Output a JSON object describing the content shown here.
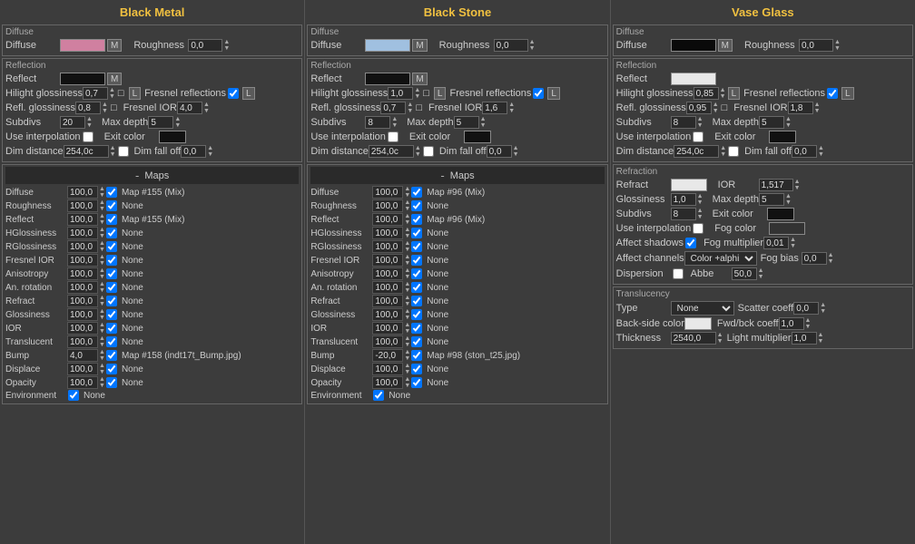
{
  "panels": [
    {
      "id": "black-metal",
      "title": "Black Metal",
      "diffuse": {
        "label": "Diffuse",
        "swatch": "swatch-pink",
        "roughness_label": "Roughness",
        "roughness_val": "0,0"
      },
      "reflection": {
        "label": "Reflection",
        "reflect_label": "Reflect",
        "reflect_swatch": "swatch-black",
        "hilight_gloss_label": "Hilight glossiness",
        "hilight_gloss_val": "0,7",
        "fresnel_refl_label": "Fresnel reflections",
        "refl_gloss_label": "Refl. glossiness",
        "refl_gloss_val": "0,8",
        "fresnel_ior_label": "Fresnel IOR",
        "fresnel_ior_val": "4,0",
        "subdivs_label": "Subdivs",
        "subdivs_val": "20",
        "max_depth_label": "Max depth",
        "max_depth_val": "5",
        "use_interp_label": "Use interpolation",
        "exit_color_label": "Exit color",
        "dim_dist_label": "Dim distance",
        "dim_dist_val": "254,0c",
        "dim_fall_label": "Dim fall off",
        "dim_fall_val": "0,0"
      },
      "maps": {
        "label": "Maps",
        "rows": [
          {
            "label": "Diffuse",
            "val": "100,0",
            "name": "Map #155 (Mix)"
          },
          {
            "label": "Roughness",
            "val": "100,0",
            "name": "None"
          },
          {
            "label": "Reflect",
            "val": "100,0",
            "name": "Map #155 (Mix)"
          },
          {
            "label": "HGlossiness",
            "val": "100,0",
            "name": "None"
          },
          {
            "label": "RGlossiness",
            "val": "100,0",
            "name": "None"
          },
          {
            "label": "Fresnel IOR",
            "val": "100,0",
            "name": "None"
          },
          {
            "label": "Anisotropy",
            "val": "100,0",
            "name": "None"
          },
          {
            "label": "An. rotation",
            "val": "100,0",
            "name": "None"
          },
          {
            "label": "Refract",
            "val": "100,0",
            "name": "None"
          },
          {
            "label": "Glossiness",
            "val": "100,0",
            "name": "None"
          },
          {
            "label": "IOR",
            "val": "100,0",
            "name": "None"
          },
          {
            "label": "Translucent",
            "val": "100,0",
            "name": "None"
          },
          {
            "label": "Bump",
            "val": "4,0",
            "name": "Map #158 (indt17t_Bump.jpg)"
          },
          {
            "label": "Displace",
            "val": "100,0",
            "name": "None"
          },
          {
            "label": "Opacity",
            "val": "100,0",
            "name": "None"
          },
          {
            "label": "Environment",
            "val": "",
            "name": "None"
          }
        ]
      }
    },
    {
      "id": "black-stone",
      "title": "Black Stone",
      "diffuse": {
        "label": "Diffuse",
        "swatch": "swatch-lightblue",
        "roughness_label": "Roughness",
        "roughness_val": "0,0"
      },
      "reflection": {
        "label": "Reflection",
        "reflect_label": "Reflect",
        "reflect_swatch": "swatch-black",
        "hilight_gloss_label": "Hilight glossiness",
        "hilight_gloss_val": "1,0",
        "fresnel_refl_label": "Fresnel reflections",
        "refl_gloss_label": "Refl. glossiness",
        "refl_gloss_val": "0,7",
        "fresnel_ior_label": "Fresnel IOR",
        "fresnel_ior_val": "1,6",
        "subdivs_label": "Subdivs",
        "subdivs_val": "8",
        "max_depth_label": "Max depth",
        "max_depth_val": "5",
        "use_interp_label": "Use interpolation",
        "exit_color_label": "Exit color",
        "dim_dist_label": "Dim distance",
        "dim_dist_val": "254,0c",
        "dim_fall_label": "Dim fall off",
        "dim_fall_val": "0,0"
      },
      "maps": {
        "label": "Maps",
        "rows": [
          {
            "label": "Diffuse",
            "val": "100,0",
            "name": "Map #96 (Mix)"
          },
          {
            "label": "Roughness",
            "val": "100,0",
            "name": "None"
          },
          {
            "label": "Reflect",
            "val": "100,0",
            "name": "Map #96 (Mix)"
          },
          {
            "label": "HGlossiness",
            "val": "100,0",
            "name": "None"
          },
          {
            "label": "RGlossiness",
            "val": "100,0",
            "name": "None"
          },
          {
            "label": "Fresnel IOR",
            "val": "100,0",
            "name": "None"
          },
          {
            "label": "Anisotropy",
            "val": "100,0",
            "name": "None"
          },
          {
            "label": "An. rotation",
            "val": "100,0",
            "name": "None"
          },
          {
            "label": "Refract",
            "val": "100,0",
            "name": "None"
          },
          {
            "label": "Glossiness",
            "val": "100,0",
            "name": "None"
          },
          {
            "label": "IOR",
            "val": "100,0",
            "name": "None"
          },
          {
            "label": "Translucent",
            "val": "100,0",
            "name": "None"
          },
          {
            "label": "Bump",
            "val": "-20,0",
            "name": "Map #98 (ston_t25.jpg)"
          },
          {
            "label": "Displace",
            "val": "100,0",
            "name": "None"
          },
          {
            "label": "Opacity",
            "val": "100,0",
            "name": "None"
          },
          {
            "label": "Environment",
            "val": "",
            "name": "None"
          }
        ]
      }
    },
    {
      "id": "vase-glass",
      "title": "Vase Glass",
      "diffuse": {
        "label": "Diffuse",
        "swatch": "swatch-verydark",
        "roughness_label": "Roughness",
        "roughness_val": "0,0"
      },
      "reflection": {
        "label": "Reflection",
        "reflect_label": "Reflect",
        "reflect_swatch": "swatch-nearwhite",
        "hilight_gloss_label": "Hilight glossiness",
        "hilight_gloss_val": "0,85",
        "fresnel_refl_label": "Fresnel reflections",
        "refl_gloss_label": "Refl. glossiness",
        "refl_gloss_val": "0,95",
        "fresnel_ior_label": "Fresnel IOR",
        "fresnel_ior_val": "1,8",
        "subdivs_label": "Subdivs",
        "subdivs_val": "8",
        "max_depth_label": "Max depth",
        "max_depth_val": "5",
        "use_interp_label": "Use interpolation",
        "exit_color_label": "Exit color",
        "dim_dist_label": "Dim distance",
        "dim_dist_val": "254,0c",
        "dim_fall_label": "Dim fall off",
        "dim_fall_val": "0,0"
      },
      "refraction": {
        "label": "Refraction",
        "refract_label": "Refract",
        "refract_swatch": "swatch-nearwhite",
        "ior_label": "IOR",
        "ior_val": "1,517",
        "gloss_label": "Glossiness",
        "gloss_val": "1,0",
        "max_depth_label": "Max depth",
        "max_depth_val": "5",
        "subdivs_label": "Subdivs",
        "subdivs_val": "8",
        "exit_color_label": "Exit color",
        "use_interp_label": "Use interpolation",
        "fog_color_label": "Fog color",
        "affect_shadows_label": "Affect shadows",
        "fog_mult_label": "Fog multiplier",
        "fog_mult_val": "0,01",
        "affect_channels_label": "Affect channels",
        "affect_channels_val": "Color +alphi",
        "fog_bias_label": "Fog bias",
        "fog_bias_val": "0,0",
        "dispersion_label": "Dispersion",
        "abbe_label": "Abbe",
        "abbe_val": "50,0"
      },
      "translucency": {
        "label": "Translucency",
        "type_label": "Type",
        "type_val": "None",
        "back_side_label": "Back-side color",
        "scatter_coeff_label": "Scatter coeff",
        "scatter_coeff_val": "0,0",
        "fwd_bck_label": "Fwd/bck coeff",
        "fwd_bck_val": "1,0",
        "thickness_label": "Thickness",
        "thickness_val": "2540,0",
        "light_mult_label": "Light multiplier",
        "light_mult_val": "1,0"
      }
    }
  ],
  "labels": {
    "m_btn": "M",
    "l_btn": "L",
    "maps": "Maps",
    "minus": "-"
  }
}
